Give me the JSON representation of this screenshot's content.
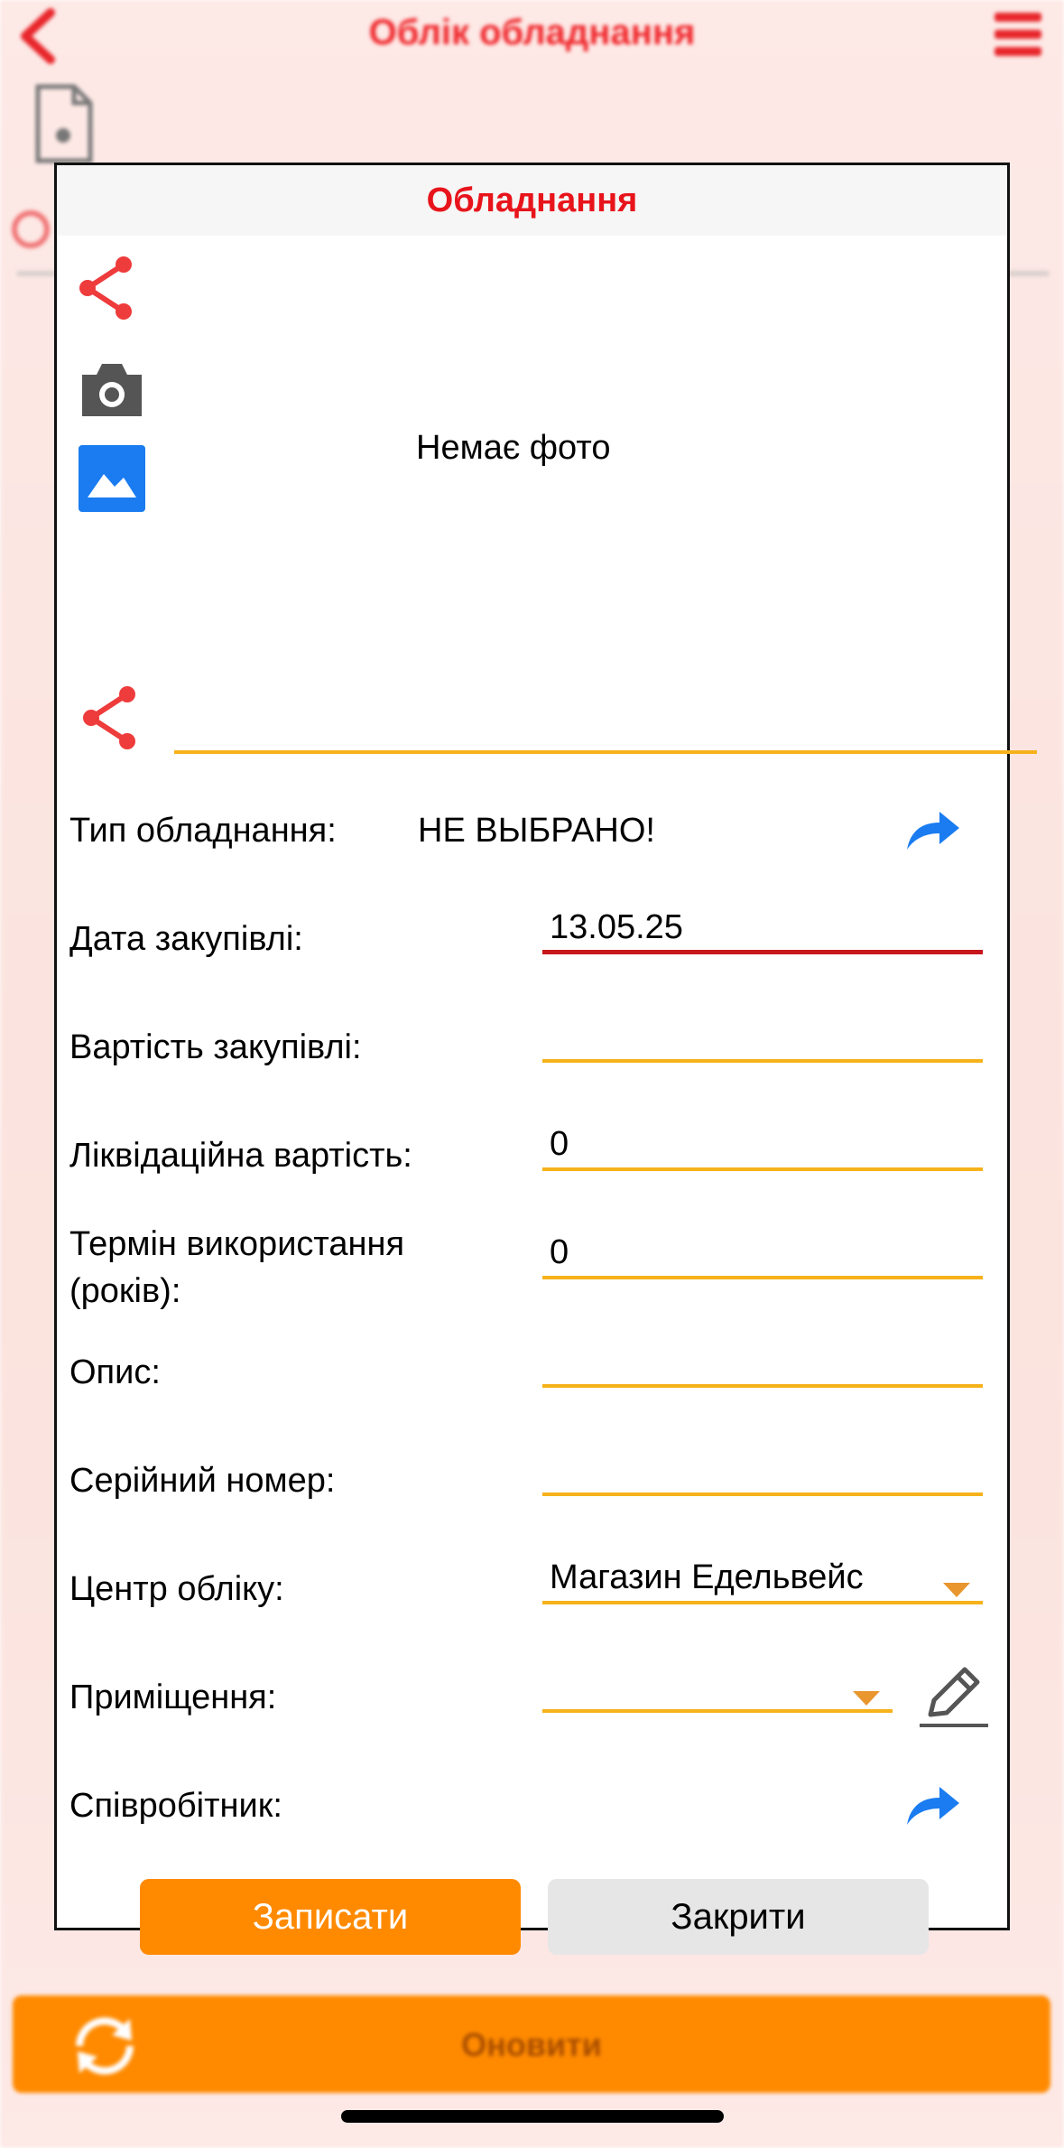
{
  "background": {
    "app_title": "Облік обладнання",
    "refresh_label": "Оновити"
  },
  "modal": {
    "title": "Обладнання",
    "photo_placeholder": "Немає фото",
    "share_link_value": "",
    "fields": {
      "equipment_type": {
        "label": "Тип обладнання:",
        "value": "НЕ ВЫБРАНО!"
      },
      "purchase_date": {
        "label": "Дата закупівлі:",
        "value": "13.05.25"
      },
      "purchase_cost": {
        "label": "Вартість закупівлі:",
        "value": ""
      },
      "liquidation_value": {
        "label": "Ліквідаційна вартість:",
        "value": "0"
      },
      "usage_term": {
        "label_line1": "Термін використання",
        "label_line2": "(років):",
        "value": "0"
      },
      "description": {
        "label": "Опис:",
        "value": ""
      },
      "serial_number": {
        "label": "Серійний номер:",
        "value": ""
      },
      "accounting_center": {
        "label": "Центр обліку:",
        "value": "Магазин Едельвейс"
      },
      "room": {
        "label": "Приміщення:",
        "value": ""
      },
      "employee": {
        "label": "Співробітник:",
        "value": ""
      }
    },
    "buttons": {
      "save": "Записати",
      "close": "Закрити"
    }
  },
  "colors": {
    "accent_red": "#e8141b",
    "underline_orange": "#f6b21b",
    "button_orange": "#ff8a00",
    "link_blue": "#1a7cf0",
    "caret_orange": "#e9962f"
  },
  "icons": [
    "back-arrow-icon",
    "hamburger-menu-icon",
    "document-icon",
    "search-icon",
    "share-icon",
    "camera-icon",
    "gallery-image-icon",
    "forward-arrow-icon",
    "pencil-icon",
    "refresh-icon"
  ]
}
